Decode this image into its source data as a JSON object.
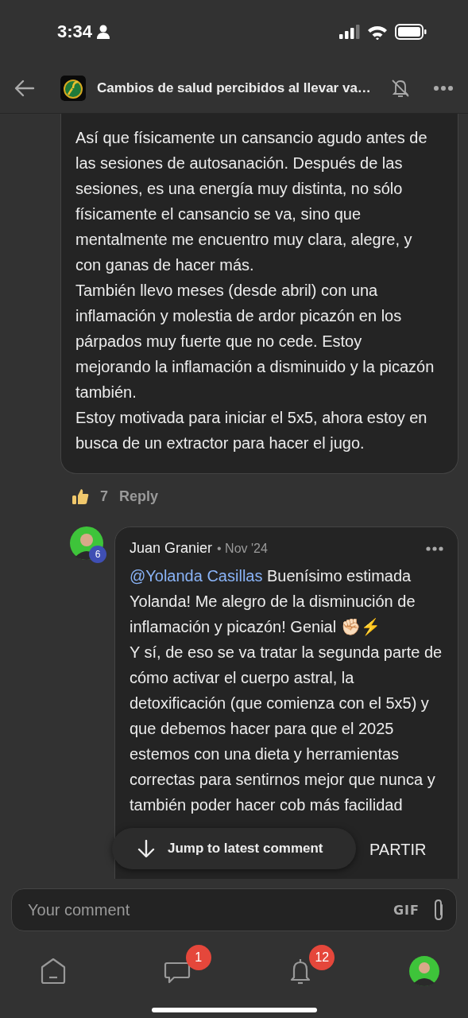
{
  "status_bar": {
    "time": "3:34"
  },
  "header": {
    "title": "Cambios de salud percibidos al llevar va…",
    "muted": true
  },
  "comment": {
    "paragraphs": [
      "Así que físicamente un cansancio agudo antes de las sesiones de autosanación. Después de las sesiones, es una energía muy distinta, no sólo físicamente el cansancio se va, sino que mentalmente me encuentro muy clara, alegre, y con ganas de hacer más.",
      "También llevo meses (desde abril) con una inflamación y molestia de ardor picazón en los párpados muy fuerte que no cede. Estoy mejorando la inflamación a disminuido y la picazón también.",
      "Estoy motivada para iniciar el 5x5, ahora estoy en busca de un extractor para hacer el jugo."
    ],
    "likes": "7",
    "reply_label": "Reply"
  },
  "reply": {
    "badge": "6",
    "author": "Juan Granier",
    "date": "• Nov '24",
    "mention": "@Yolanda Casillas",
    "first_text": "Buenísimo estimada Yolanda! Me alegro de la disminución de inflamación y picazón! Genial ✊🏻⚡",
    "paragraphs": [
      "Y sí, de eso se va tratar la segunda parte de cómo activar el cuerpo astral, la detoxificación (que comienza con el 5x5) y que debemos hacer para que el 2025 estemos con una dieta y herramientas correctas para sentirnos mejor que nunca y también poder hacer cob más facilidad"
    ],
    "tail": "PARTIR"
  },
  "jump_button": "Jump to latest comment",
  "composer": {
    "placeholder": "Your comment",
    "gif": "GIF"
  },
  "nav": [
    {
      "kind": "home"
    },
    {
      "kind": "chat",
      "badge": "1"
    },
    {
      "kind": "bell",
      "badge": "12"
    },
    {
      "kind": "profile"
    }
  ]
}
